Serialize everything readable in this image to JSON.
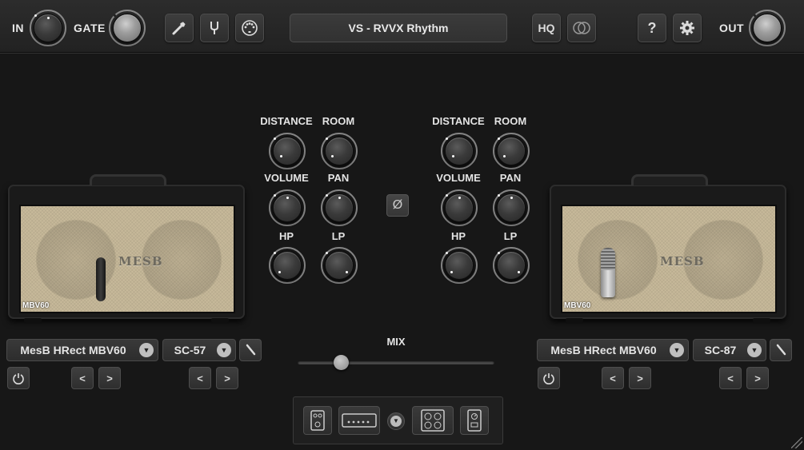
{
  "topbar": {
    "in_label": "IN",
    "gate_label": "GATE",
    "out_label": "OUT",
    "preset_name": "VS - RVVX Rhythm",
    "hq_label": "HQ",
    "help_label": "?",
    "icons": [
      "guitar-cable-icon",
      "tuner-fork-icon",
      "midi-icon",
      "compare-icon",
      "gear-icon"
    ]
  },
  "mic_panel_left": {
    "distance_label": "DISTANCE",
    "room_label": "ROOM",
    "volume_label": "VOLUME",
    "pan_label": "PAN",
    "hp_label": "HP",
    "lp_label": "LP"
  },
  "mic_panel_right": {
    "distance_label": "DISTANCE",
    "room_label": "ROOM",
    "volume_label": "VOLUME",
    "pan_label": "PAN",
    "hp_label": "HP",
    "lp_label": "LP"
  },
  "phase_symbol": "Ø",
  "cab_left": {
    "brand": "MESB",
    "model_badge": "MBV60",
    "cab_name": "MesB HRect MBV60",
    "mic_name": "SC-57",
    "prev": "<",
    "next": ">"
  },
  "cab_right": {
    "brand": "MESB",
    "model_badge": "MBV60",
    "cab_name": "MesB HRect MBV60",
    "mic_name": "SC-87",
    "prev": "<",
    "next": ">"
  },
  "mix": {
    "label": "MIX",
    "value": 0.22
  },
  "colors": {
    "background": "#171717",
    "grill": "#c7b99a",
    "text": "#e6e6e6"
  }
}
